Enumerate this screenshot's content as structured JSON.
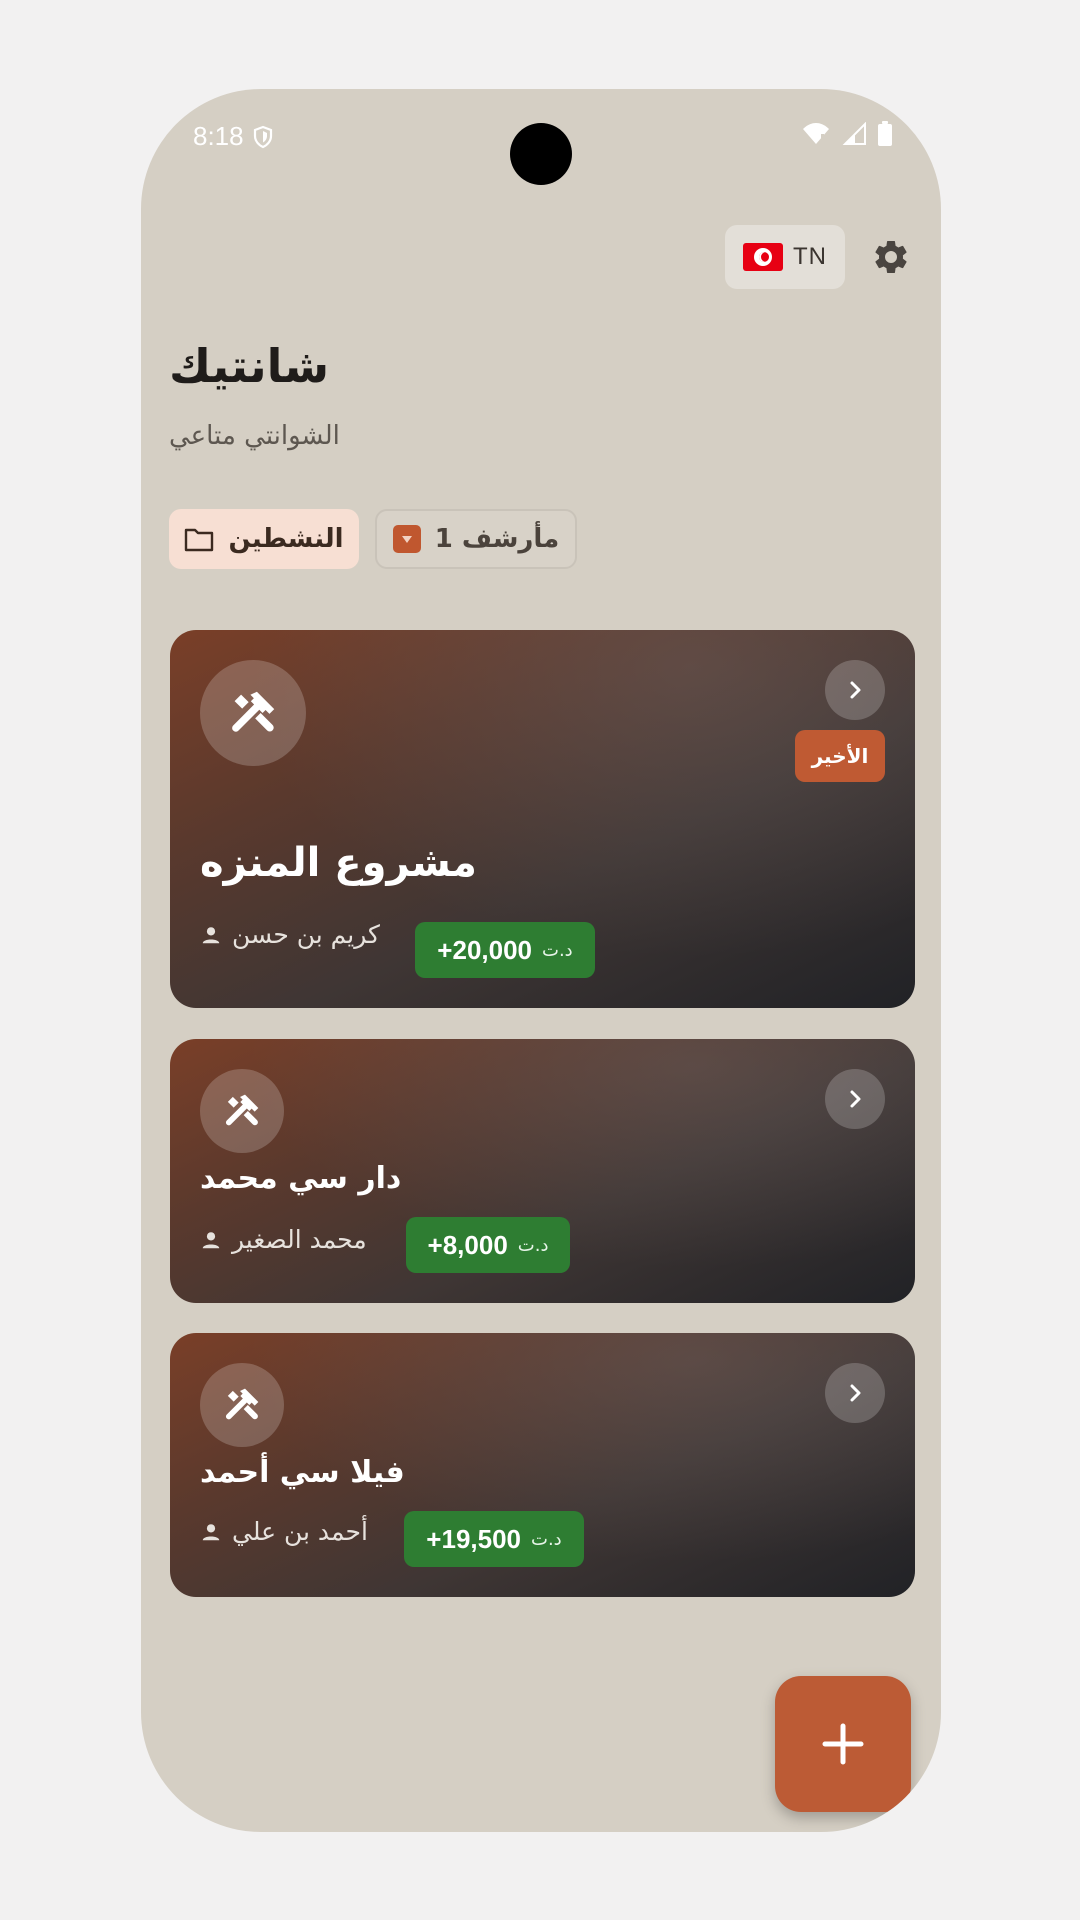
{
  "status_bar": {
    "time": "8:18"
  },
  "header": {
    "language_code": "TN",
    "title": "شانتيك",
    "subtitle": "الشوانتي متاعي"
  },
  "tabs": {
    "active_label": "النشطين",
    "archive_label": "مأرشف 1"
  },
  "projects": [
    {
      "name": "مشروع المنزه",
      "owner": "كريم بن حسن",
      "amount": "+20,000",
      "currency": "د.ت",
      "badge": "الأخير"
    },
    {
      "name": "دار سي محمد",
      "owner": "محمد الصغير",
      "amount": "+8,000",
      "currency": "د.ت"
    },
    {
      "name": "فيلا سي أحمد",
      "owner": "أحمد بن علي",
      "amount": "+19,500",
      "currency": "د.ت"
    }
  ],
  "colors": {
    "background": "#d5cfc4",
    "accent": "#bc5b35",
    "positive": "#2e7d32",
    "active_tab": "#f7dfd3"
  },
  "icons": [
    "shield-icon",
    "wifi-icon",
    "signal-icon",
    "battery-icon",
    "tunisia-flag-icon",
    "gear-icon",
    "folder-icon",
    "archive-icon",
    "tools-icon",
    "chevron-right-icon",
    "person-icon",
    "plus-icon"
  ]
}
